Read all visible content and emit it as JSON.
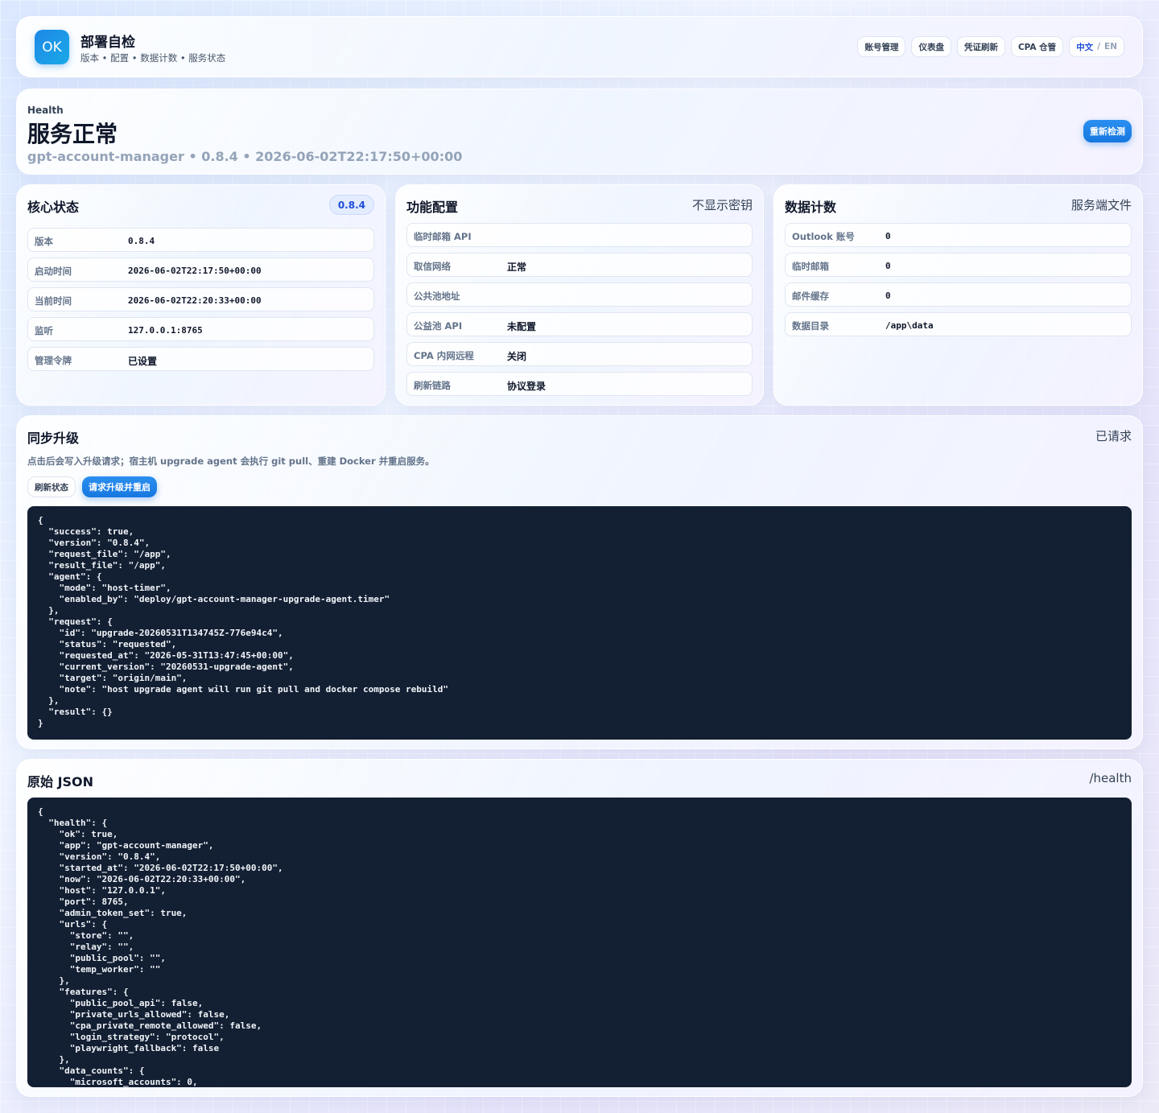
{
  "header": {
    "logo": "OK",
    "title": "部署自检",
    "subtitle": "版本 • 配置 • 数据计数 • 服务状态",
    "nav": [
      "账号管理",
      "仪表盘",
      "凭证刷新",
      "CPA 仓管"
    ],
    "lang_active": "中文",
    "lang_sep": "/",
    "lang_other": "EN"
  },
  "health": {
    "eyebrow": "Health",
    "status": "服务正常",
    "meta": "gpt-account-manager • 0.8.4 • 2026-06-02T22:17:50+00:00",
    "recheck_label": "重新检测"
  },
  "core": {
    "title": "核心状态",
    "badge": "0.8.4",
    "rows": [
      {
        "k": "版本",
        "v": "0.8.4"
      },
      {
        "k": "启动时间",
        "v": "2026-06-02T22:17:50+00:00"
      },
      {
        "k": "当前时间",
        "v": "2026-06-02T22:20:33+00:00"
      },
      {
        "k": "监听",
        "v": "127.0.0.1:8765"
      },
      {
        "k": "管理令牌",
        "v": "已设置"
      }
    ]
  },
  "features": {
    "title": "功能配置",
    "note": "不显示密钥",
    "rows": [
      {
        "k": "临时邮箱 API",
        "v": ""
      },
      {
        "k": "取信网络",
        "v": "正常"
      },
      {
        "k": "公共池地址",
        "v": ""
      },
      {
        "k": "公益池 API",
        "v": "未配置"
      },
      {
        "k": "CPA 内网远程",
        "v": "关闭"
      },
      {
        "k": "刷新链路",
        "v": "协议登录"
      }
    ]
  },
  "counts": {
    "title": "数据计数",
    "note": "服务端文件",
    "rows": [
      {
        "k": "Outlook 账号",
        "v": "0"
      },
      {
        "k": "临时邮箱",
        "v": "0"
      },
      {
        "k": "邮件缓存",
        "v": "0"
      },
      {
        "k": "数据目录",
        "v": "/app\\data"
      }
    ]
  },
  "upgrade": {
    "title": "同步升级",
    "status": "已请求",
    "desc": "点击后会写入升级请求；宿主机 upgrade agent 会执行 git pull、重建 Docker 并重启服务。",
    "refresh_label": "刷新状态",
    "request_label": "请求升级并重启",
    "code": "{\n  \"success\": true,\n  \"version\": \"0.8.4\",\n  \"request_file\": \"/app\",\n  \"result_file\": \"/app\",\n  \"agent\": {\n    \"mode\": \"host-timer\",\n    \"enabled_by\": \"deploy/gpt-account-manager-upgrade-agent.timer\"\n  },\n  \"request\": {\n    \"id\": \"upgrade-20260531T134745Z-776e94c4\",\n    \"status\": \"requested\",\n    \"requested_at\": \"2026-05-31T13:47:45+00:00\",\n    \"current_version\": \"20260531-upgrade-agent\",\n    \"target\": \"origin/main\",\n    \"note\": \"host upgrade agent will run git pull and docker compose rebuild\"\n  },\n  \"result\": {}\n}"
  },
  "raw": {
    "title": "原始 JSON",
    "endpoint": "/health",
    "code": "{\n  \"health\": {\n    \"ok\": true,\n    \"app\": \"gpt-account-manager\",\n    \"version\": \"0.8.4\",\n    \"started_at\": \"2026-06-02T22:17:50+00:00\",\n    \"now\": \"2026-06-02T22:20:33+00:00\",\n    \"host\": \"127.0.0.1\",\n    \"port\": 8765,\n    \"admin_token_set\": true,\n    \"urls\": {\n      \"store\": \"\",\n      \"relay\": \"\",\n      \"public_pool\": \"\",\n      \"temp_worker\": \"\"\n    },\n    \"features\": {\n      \"public_pool_api\": false,\n      \"private_urls_allowed\": false,\n      \"cpa_private_remote_allowed\": false,\n      \"login_strategy\": \"protocol\",\n      \"playwright_fallback\": false\n    },\n    \"data_counts\": {\n      \"microsoft_accounts\": 0,"
  }
}
